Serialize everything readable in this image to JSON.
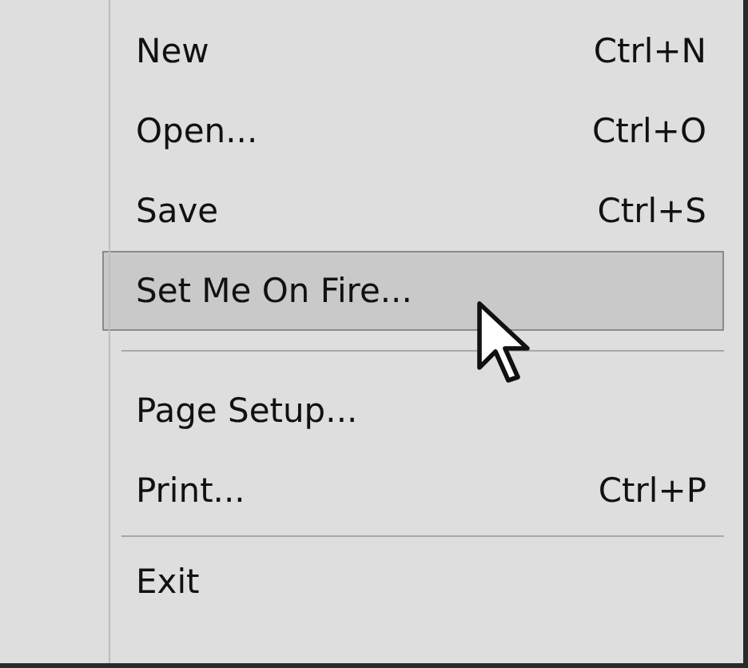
{
  "menu": {
    "items": [
      {
        "kind": "item",
        "label": "New",
        "shortcut": "Ctrl+N",
        "selected": false
      },
      {
        "kind": "item",
        "label": "Open...",
        "shortcut": "Ctrl+O",
        "selected": false
      },
      {
        "kind": "item",
        "label": "Save",
        "shortcut": "Ctrl+S",
        "selected": false
      },
      {
        "kind": "item",
        "label": "Set Me On Fire...",
        "selected": true
      },
      {
        "kind": "separator"
      },
      {
        "kind": "item",
        "label": "Page Setup...",
        "selected": false
      },
      {
        "kind": "item",
        "label": "Print...",
        "shortcut": "Ctrl+P",
        "selected": false
      },
      {
        "kind": "separator"
      },
      {
        "kind": "item",
        "label": "Exit",
        "selected": false
      }
    ]
  }
}
